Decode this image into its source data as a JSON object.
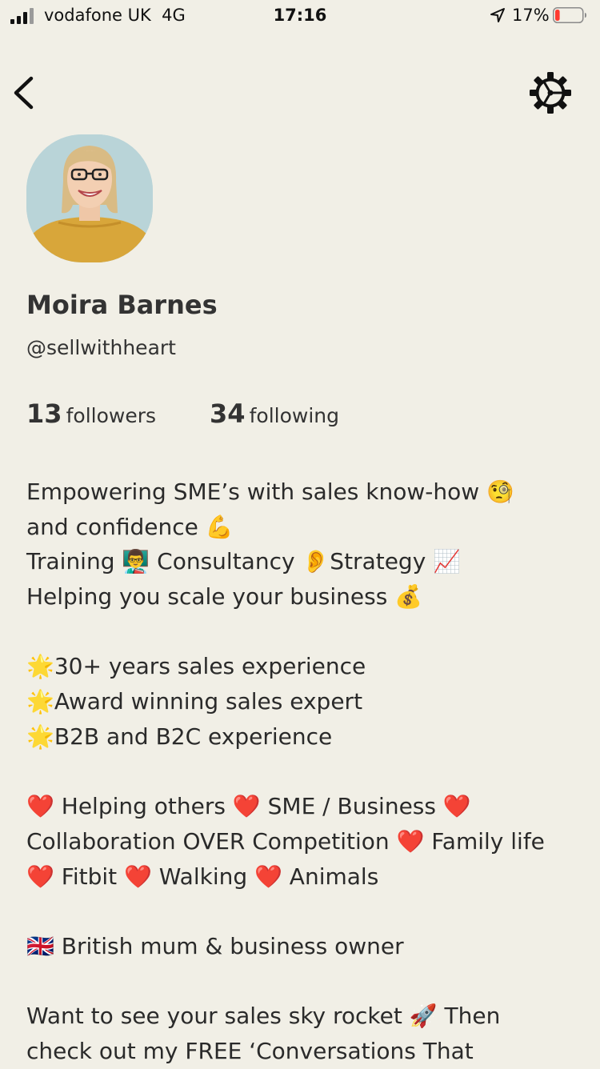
{
  "status_bar": {
    "carrier": "vodafone UK",
    "network": "4G",
    "time": "17:16",
    "battery_percent": "17%",
    "battery_level": 0.17,
    "battery_color": "#ff3b30"
  },
  "nav": {
    "back_icon": "chevron-left-icon",
    "settings_icon": "gear-icon"
  },
  "profile": {
    "name": "Moira Barnes",
    "handle": "@sellwithheart",
    "followers_count": "13",
    "followers_label": "followers",
    "following_count": "34",
    "following_label": "following"
  },
  "bio": {
    "lines": [
      "Empowering SME’s with sales know-how 🧐",
      "and confidence 💪",
      "Training 👨‍🏫 Consultancy 👂Strategy 📈",
      "Helping you scale your business 💰",
      "",
      "🌟30+ years sales experience",
      "🌟Award winning sales expert",
      "🌟B2B and B2C experience",
      "",
      " ❤️ Helping others ❤️ SME / Business ❤️",
      "Collaboration OVER Competition ❤️ Family life",
      "❤️ Fitbit ❤️ Walking ❤️ Animals",
      "",
      "🇬🇧 British mum & business owner",
      "",
      "Want to see your sales sky rocket 🚀 Then",
      "check out my FREE ‘Conversations That"
    ]
  }
}
